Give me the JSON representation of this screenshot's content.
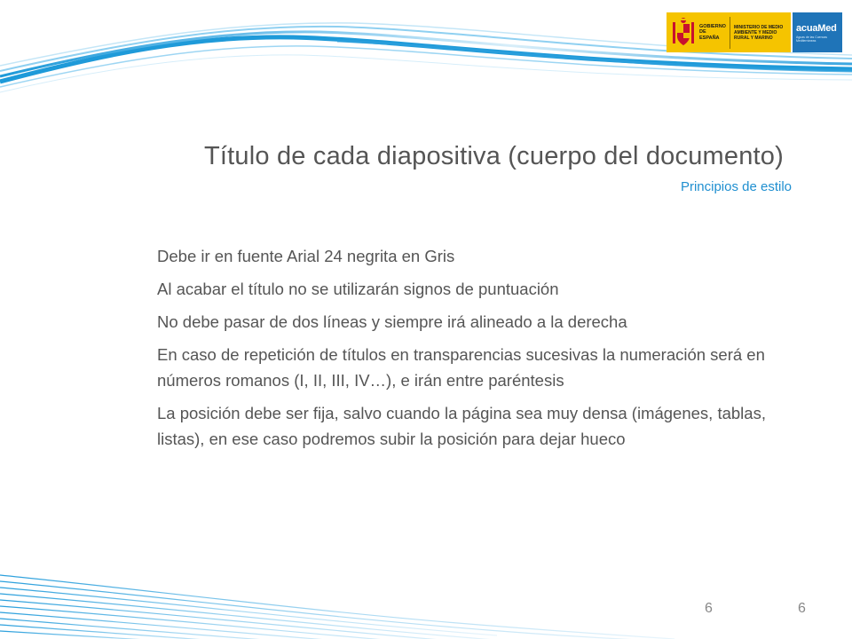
{
  "header": {
    "gov_logo_text": "GOBIERNO DE ESPAÑA",
    "ministry_text": "MINISTERIO DE MEDIO AMBIENTE Y MEDIO RURAL Y MARINO",
    "brand_name": "acuaMed",
    "brand_tagline": "Aguas de las Cuencas Mediterráneas"
  },
  "slide": {
    "title": "Título de cada diapositiva (cuerpo del documento)",
    "subtitle": "Principios de estilo",
    "bullets": [
      "Debe ir en fuente Arial 24 negrita en Gris",
      "Al acabar el título no se utilizarán signos de puntuación",
      "No debe pasar de dos líneas y siempre irá alineado a la derecha",
      "En caso de repetición de títulos en transparencias sucesivas la numeración será en números romanos (I, II, III, IV…), e irán entre paréntesis",
      "La posición debe ser fija, salvo cuando la página sea muy densa (imágenes, tablas, listas), en ese caso podremos subir la posición para dejar hueco"
    ]
  },
  "footer": {
    "page_number_left": "6",
    "page_number_right": "6"
  },
  "colors": {
    "wave_blue": "#2aa2e0",
    "wave_light": "#cfe9f7",
    "title_gray": "#555555",
    "subtitle_blue": "#1f8fd0",
    "gov_yellow": "#f5c400",
    "brand_blue": "#1f74b8"
  }
}
